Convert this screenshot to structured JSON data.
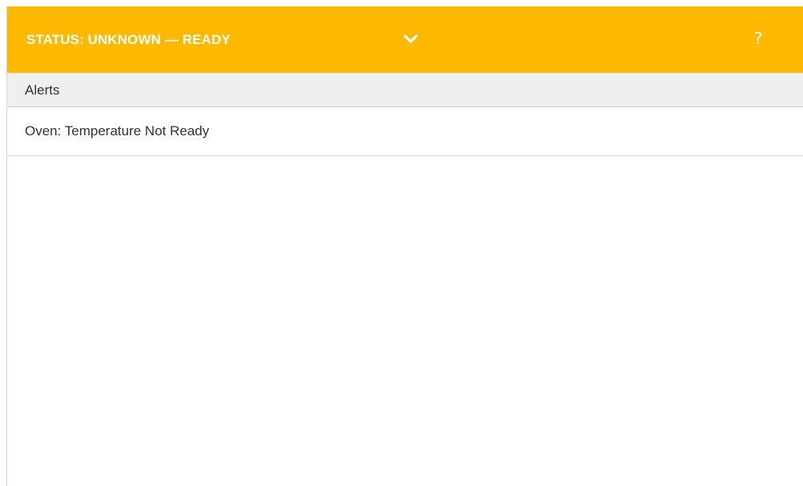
{
  "status_bar": {
    "title": "STATUS: UNKNOWN — READY",
    "expand_icon": "chevron-down-icon",
    "help_label": "?",
    "color": "#ffb900"
  },
  "alerts": {
    "header": "Alerts",
    "items": [
      {
        "label": "Oven: Temperature Not Ready"
      }
    ]
  }
}
